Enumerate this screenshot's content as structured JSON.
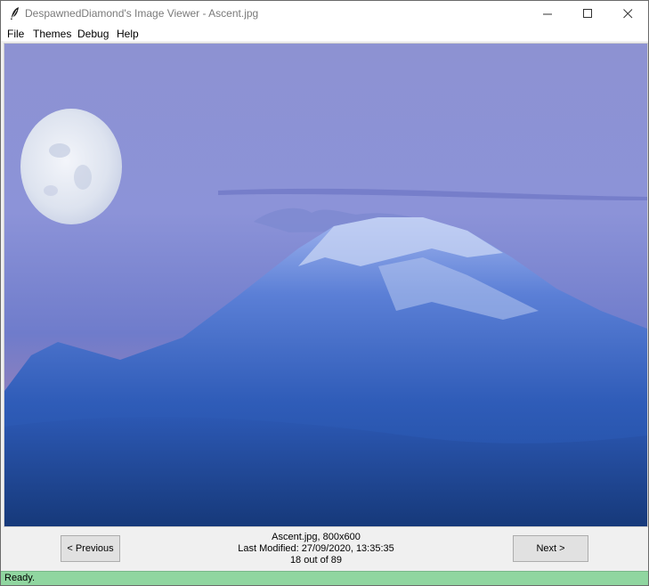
{
  "window": {
    "title": "DespawnedDiamond's Image Viewer - Ascent.jpg"
  },
  "menu": {
    "items": [
      "File",
      "Themes",
      "Debug",
      "Help"
    ]
  },
  "image": {
    "description_icon": "mountain-photo",
    "colors": {
      "sky": "#8f97d8",
      "mountain": "#1f4d9f",
      "moon": "#e9edf5"
    }
  },
  "controls": {
    "previous_label": "< Previous",
    "next_label": "Next >",
    "info": {
      "file_line": "Ascent.jpg, 800x600",
      "modified_line": "Last Modified: 27/09/2020, 13:35:35",
      "position_line": "18 out of 89"
    }
  },
  "status": {
    "text": "Ready.",
    "color": "#90d6a0"
  }
}
